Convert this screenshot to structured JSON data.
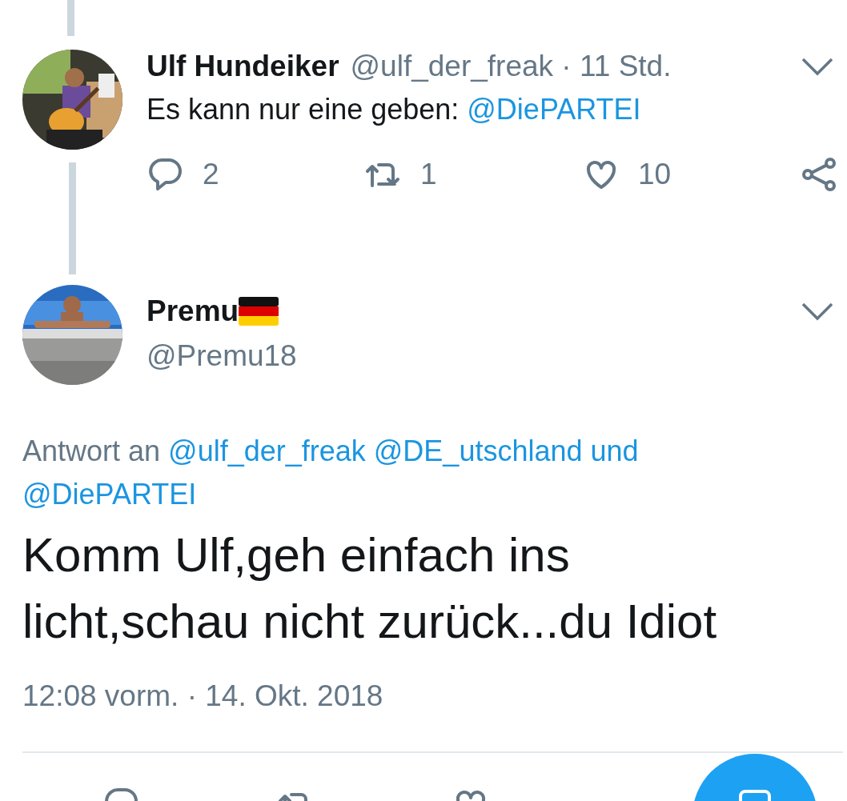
{
  "parent_tweet": {
    "name": "Ulf Hundeiker",
    "handle_time": "@ulf_der_freak · 11 Std.",
    "text": [
      {
        "kind": "plain",
        "text": "Es kann nur eine geben:"
      },
      {
        "kind": "mention",
        "text": "@DiePARTEI"
      }
    ],
    "actions": [
      {
        "kind": "reply",
        "count": "2"
      },
      {
        "kind": "retweet",
        "count": "1"
      },
      {
        "kind": "like",
        "count": "10"
      },
      {
        "kind": "share"
      }
    ]
  },
  "main_tweet": {
    "name": "Premu",
    "handle": "@Premu18",
    "reply_label": "Antwort an",
    "reply_links": [
      "@ulf_der_freak",
      "@DE_utschland und",
      "@DiePARTEI"
    ],
    "text": "Komm Ulf,geh einfach ins licht,schau nicht zurück...du Idiot",
    "timestamp": "12:08 vorm. · 14. Okt. 2018",
    "actions": [
      {
        "kind": "reply"
      },
      {
        "kind": "retweet"
      },
      {
        "kind": "like"
      }
    ]
  }
}
